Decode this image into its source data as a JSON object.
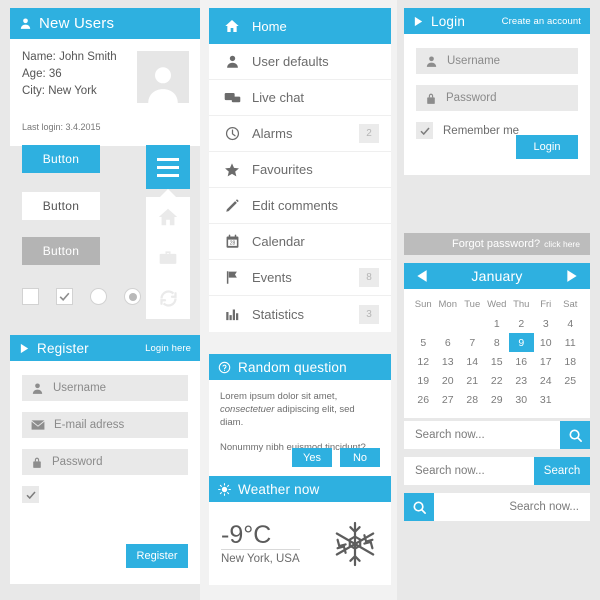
{
  "theme": {
    "accent": "#2eb0e0",
    "page_bg": "#e8e8e8",
    "panel_bg": "#ffffff",
    "field_bg": "#e9e9e9",
    "gray_bar": "#bcbcbc"
  },
  "new_users": {
    "title": "New Users",
    "icon": "user-icon",
    "name_line": "Name: John Smith",
    "age_line": "Age: 36",
    "city_line": "City: New York",
    "last_login": "Last login: 3.4.2015"
  },
  "buttons": {
    "primary": "Button",
    "white": "Button",
    "gray": "Button"
  },
  "controls": {
    "checkbox_empty": "checkbox-unchecked",
    "checkbox_checked": "checkbox-checked",
    "radio_empty": "radio-unselected",
    "radio_selected": "radio-selected"
  },
  "flyout": {
    "items": [
      "home-icon",
      "briefcase-icon",
      "refresh-icon"
    ]
  },
  "register": {
    "title": "Register",
    "login_here": "Login here",
    "username_placeholder": "Username",
    "email_placeholder": "E-mail adress",
    "password_placeholder": "Password",
    "submit_label": "Register"
  },
  "menu": {
    "items": [
      {
        "label": "Home",
        "icon": "home-icon",
        "badge": "",
        "active": true
      },
      {
        "label": "User defaults",
        "icon": "user-icon",
        "badge": "",
        "active": false
      },
      {
        "label": "Live chat",
        "icon": "chat-icon",
        "badge": "",
        "active": false
      },
      {
        "label": "Alarms",
        "icon": "clock-icon",
        "badge": "2",
        "active": false
      },
      {
        "label": "Favourites",
        "icon": "star-icon",
        "badge": "",
        "active": false
      },
      {
        "label": "Edit comments",
        "icon": "pencil-icon",
        "badge": "",
        "active": false
      },
      {
        "label": "Calendar",
        "icon": "calendar-icon",
        "badge": "",
        "active": false
      },
      {
        "label": "Events",
        "icon": "flag-icon",
        "badge": "8",
        "active": false
      },
      {
        "label": "Statistics",
        "icon": "bar-chart-icon",
        "badge": "3",
        "active": false
      }
    ]
  },
  "question": {
    "title": "Random question",
    "icon": "question-mark-icon",
    "body_lead": "Lorem ipsum dolor sit amet, ",
    "body_em": "consectetuer",
    "body_tail": " adipiscing elit, sed diam.",
    "body_q": "Nonummy nibh euismod tincidunt?",
    "yes_label": "Yes",
    "no_label": "No"
  },
  "weather": {
    "title": "Weather now",
    "icon": "sun-icon",
    "temperature": "-9°C",
    "location": "New York, USA",
    "condition_icon": "snowflake-icon"
  },
  "login": {
    "title": "Login",
    "create_account": "Create an account",
    "username_placeholder": "Username",
    "password_placeholder": "Password",
    "remember_label": "Remember me",
    "submit_label": "Login",
    "forgot_text": "Forgot password?",
    "forgot_link": "click here"
  },
  "calendar": {
    "month": "January",
    "prev_icon": "arrow-left-icon",
    "next_icon": "arrow-right-icon",
    "weekdays": [
      "Sun",
      "Mon",
      "Tue",
      "Wed",
      "Thu",
      "Fri",
      "Sat"
    ],
    "weeks": [
      [
        "",
        "",
        "",
        "1",
        "2",
        "3",
        "4"
      ],
      [
        "5",
        "6",
        "7",
        "8",
        "9",
        "10",
        "11"
      ],
      [
        "12",
        "13",
        "14",
        "15",
        "16",
        "17",
        "18"
      ],
      [
        "19",
        "20",
        "21",
        "22",
        "23",
        "24",
        "25"
      ],
      [
        "26",
        "27",
        "28",
        "29",
        "30",
        "31",
        ""
      ]
    ],
    "selected_day": "9"
  },
  "search": {
    "placeholder": "Search now...",
    "button_label": "Search",
    "icon": "search-icon"
  }
}
